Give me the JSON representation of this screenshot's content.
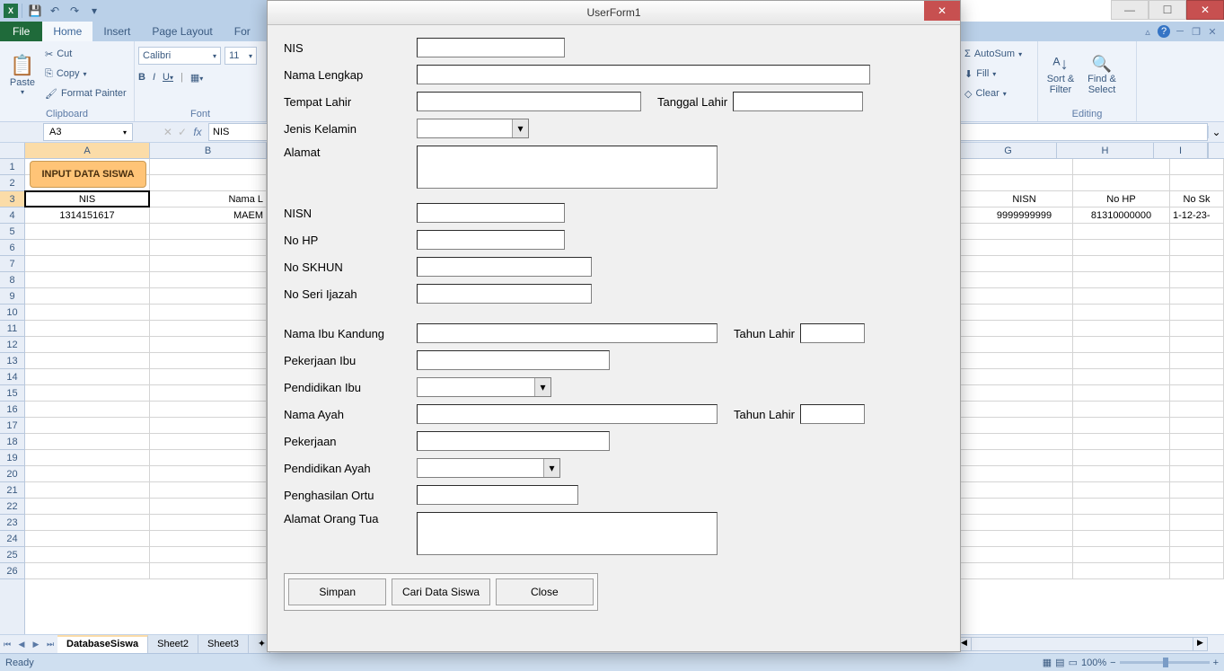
{
  "qat": {
    "app": "X"
  },
  "window_controls": {
    "min": "—",
    "max": "☐",
    "close": "✕"
  },
  "tabs": {
    "file": "File",
    "home": "Home",
    "insert": "Insert",
    "page_layout": "Page Layout",
    "formulas_partial": "For"
  },
  "ribbon": {
    "clipboard": {
      "paste": "Paste",
      "cut": "Cut",
      "copy": "Copy",
      "format_painter": "Format Painter",
      "label": "Clipboard"
    },
    "font": {
      "name": "Calibri",
      "size": "11",
      "bold": "B",
      "italic": "I",
      "underline": "U",
      "label": "Font"
    },
    "editing": {
      "autosum": "AutoSum",
      "fill": "Fill",
      "clear": "Clear",
      "sort_filter": "Sort & Filter",
      "find_select": "Find & Select",
      "label": "Editing"
    }
  },
  "fx": {
    "namebox": "A3",
    "fx_label": "fx",
    "formula": "NIS"
  },
  "cols": {
    "A": "A",
    "G": "G",
    "H": "H",
    "I": "No Sk"
  },
  "rows_left": [
    "1",
    "2",
    "3",
    "4",
    "5",
    "6",
    "7",
    "8",
    "9",
    "10",
    "11",
    "12",
    "13",
    "14",
    "15",
    "16",
    "17",
    "18",
    "19",
    "20",
    "21",
    "22",
    "23",
    "24",
    "25",
    "26"
  ],
  "sheet_left": {
    "input_button": "INPUT DATA SISWA",
    "h_nis": "NIS",
    "h_nama": "Nama L",
    "v_nis": "1314151617",
    "v_nama": "MAEM"
  },
  "sheet_right": {
    "h_nisn": "NISN",
    "h_nohp": "No HP",
    "h_nosk": "No Sk",
    "v_nisn": "9999999999",
    "v_nohp": "81310000000",
    "v_nosk": "1-12-23-"
  },
  "sheettabs": {
    "t1": "DatabaseSiswa",
    "t2": "Sheet2",
    "t3": "Sheet3"
  },
  "status": {
    "ready": "Ready",
    "zoom": "100%"
  },
  "userform": {
    "title": "UserForm1",
    "labels": {
      "nis": "NIS",
      "nama_lengkap": "Nama Lengkap",
      "tempat_lahir": "Tempat Lahir",
      "tanggal_lahir": "Tanggal Lahir",
      "jenis_kelamin": "Jenis Kelamin",
      "alamat": "Alamat",
      "nisn": "NISN",
      "no_hp": "No HP",
      "no_skhun": "No SKHUN",
      "no_seri_ijazah": "No Seri Ijazah",
      "nama_ibu": "Nama Ibu Kandung",
      "tahun_lahir": "Tahun Lahir",
      "pekerjaan_ibu": "Pekerjaan Ibu",
      "pendidikan_ibu": "Pendidikan Ibu",
      "nama_ayah": "Nama Ayah",
      "tahun_lahir2": "Tahun Lahir",
      "pekerjaan": "Pekerjaan",
      "pendidikan_ayah": "Pendidikan Ayah",
      "penghasilan_ortu": "Penghasilan Ortu",
      "alamat_ortu": "Alamat Orang Tua"
    },
    "buttons": {
      "simpan": "Simpan",
      "cari": "Cari Data Siswa",
      "close": "Close"
    }
  }
}
